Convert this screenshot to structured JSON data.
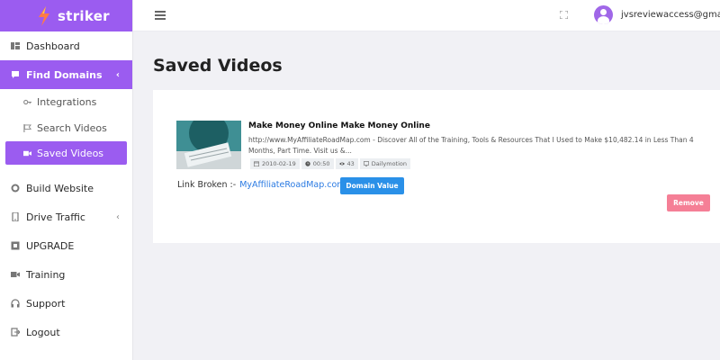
{
  "brand": {
    "name": "striker",
    "accent": "#9b5cf0"
  },
  "sidebar": {
    "items": [
      {
        "label": "Dashboard",
        "icon": "dashboard-icon"
      },
      {
        "label": "Find Domains",
        "icon": "chat-icon",
        "active": true,
        "children": [
          {
            "label": "Integrations",
            "icon": "key-icon"
          },
          {
            "label": "Search Videos",
            "icon": "flag-icon"
          },
          {
            "label": "Saved Videos",
            "icon": "video-icon",
            "current": true
          }
        ]
      },
      {
        "label": "Build Website",
        "icon": "wordpress-icon"
      },
      {
        "label": "Drive Traffic",
        "icon": "mobile-icon"
      },
      {
        "label": "UPGRADE",
        "icon": "upgrade-icon"
      },
      {
        "label": "Training",
        "icon": "video-icon"
      },
      {
        "label": "Support",
        "icon": "headphones-icon"
      },
      {
        "label": "Logout",
        "icon": "logout-icon"
      }
    ]
  },
  "header": {
    "user_email": "jvsreviewaccess@gmail.com"
  },
  "main": {
    "title": "Saved Videos",
    "video": {
      "title": "Make Money Online Make Money Online",
      "description": "http://www.MyAffiliateRoadMap.com - Discover All of the Training, Tools & Resources That I Used to Make $10,482.14 in Less Than 4 Months, Part Time. Visit us &...",
      "date": "2010-02-19",
      "duration": "00:50",
      "views": "43",
      "platform": "Dailymotion"
    },
    "link_broken_label": "Link Broken :-",
    "link_url": "MyAffiliateRoadMap.com",
    "domain_button": "Domain Value",
    "remove_button": "Remove"
  },
  "colors": {
    "primary_blue": "#2a90e8",
    "remove_pink": "#f57f96"
  }
}
